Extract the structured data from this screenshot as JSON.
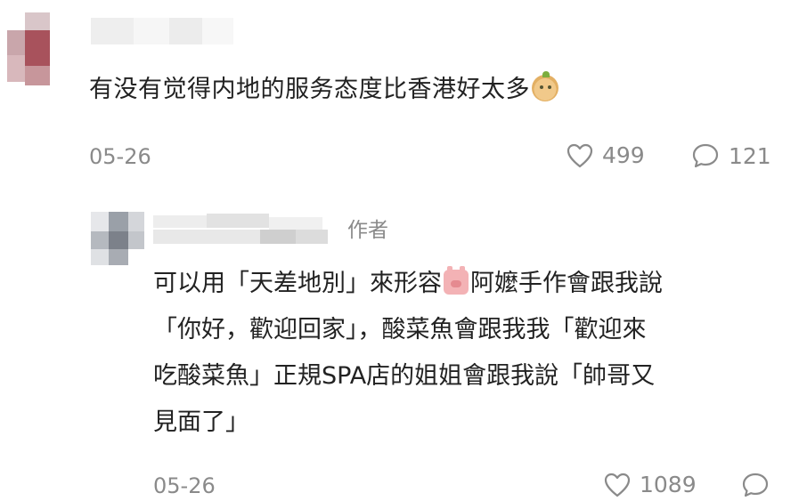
{
  "comment": {
    "text": "有没有觉得内地的服务态度比香港好太多",
    "emoji": "pear-face-emoji",
    "date": "05-26",
    "likes": "499",
    "replies": "121"
  },
  "reply": {
    "author_tag": "作者",
    "line1_a": "可以用「天差地別」來形容",
    "emoji": "pig-face-emoji",
    "line1_b": "阿嬤手作會跟我說",
    "line2": "「你好，歡迎回家」，酸菜魚會跟我我「歡迎來",
    "line3": "吃酸菜魚」正規SPA店的姐姐會跟我說「帥哥又",
    "line4": "見面了」",
    "date": "05-26",
    "likes": "1089"
  },
  "colors": {
    "text": "#222222",
    "muted": "#8a8a8a",
    "background": "#ffffff"
  }
}
